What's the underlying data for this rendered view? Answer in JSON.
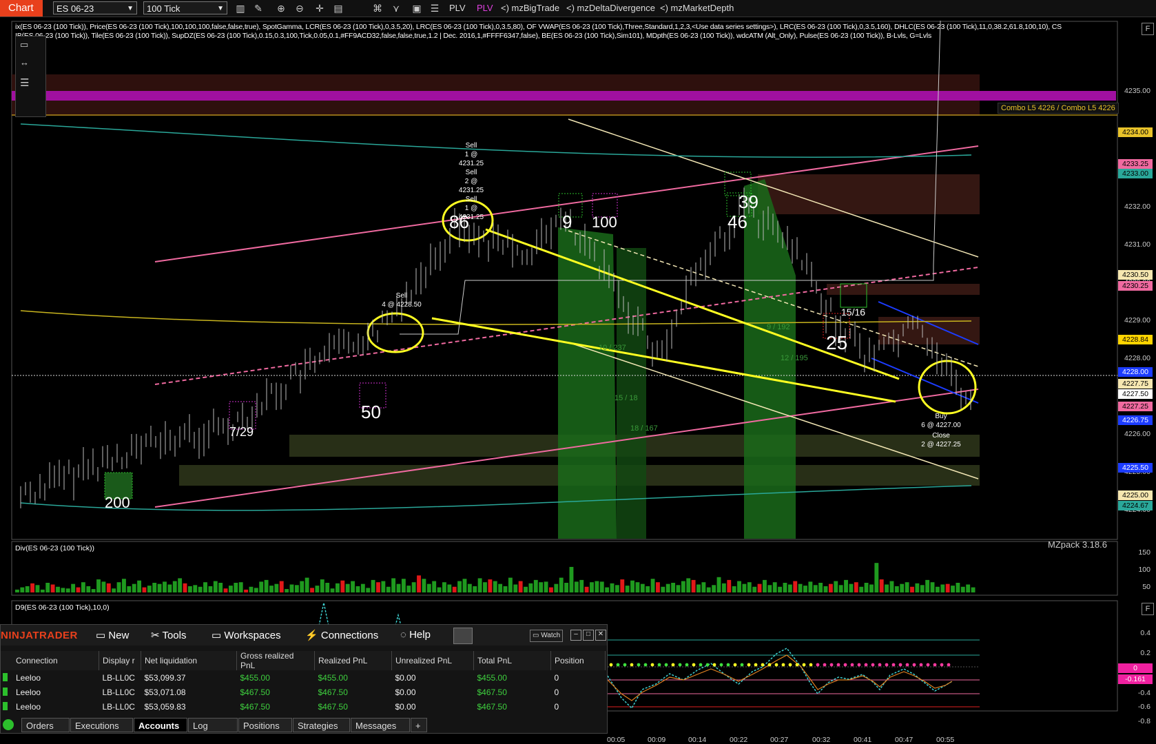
{
  "toolbar": {
    "chart_tab": "Chart",
    "instrument": "ES 06-23",
    "interval": "100 Tick",
    "plv1": "PLV",
    "plv2": "PLV",
    "addons": [
      "mzBigTrade",
      "mzDeltaDivergence",
      "mzMarketDepth"
    ]
  },
  "indicator_line1": "ix(ES 06-23 (100 Tick)), Price(ES 06-23 (100 Tick),100,100,100,false,false,true), SpotGamma, LCR(ES 06-23 (100 Tick),0,3.5,20), LRC(ES 06-23 (100 Tick),0,3.5,80), OF VWAP(ES 06-23 (100 Tick),Three,Standard,1,2,3,<Use data series settings>), LRC(ES 06-23 (100 Tick),0,3.5,160), DHLC(ES 06-23 (100 Tick),11,0,38.2,61.8,100,10), CS",
  "indicator_line2": "IB(ES 06-23 (100 Tick)), Tile(ES 06-23 (100 Tick)), SupDZ(ES 06-23 (100 Tick),0.15,0.3,100,Tick,0.05,0.1,#FF9ACD32,false,false,true,1.2 | Dec. 2016,1,#FFFF6347,false), BE(ES 06-23 (100 Tick),Sim101), MDpth(ES 06-23 (100 Tick)), wdcATM (Alt_Only), Pulse(ES 06-23 (100 Tick)), B-Lvls, G=Lvls",
  "combo_label": "Combo L5 4226 / Combo L5 4226",
  "price_axis": [
    "4235.00",
    "4234.00",
    "4233.00",
    "4232.00",
    "4231.00",
    "4230.00",
    "4229.00",
    "4228.00",
    "4227.00",
    "4226.00",
    "4225.00",
    "4224.00"
  ],
  "price_tags": [
    {
      "text": "4234.00",
      "color": "#e8c22a"
    },
    {
      "text": "4233.25",
      "color": "#f06aa0"
    },
    {
      "text": "4233.00",
      "color": "#2aa89a"
    },
    {
      "text": "4230.50",
      "color": "#f6e7b0"
    },
    {
      "text": "4230.25",
      "color": "#f06aa0"
    },
    {
      "text": "4228.84",
      "color": "#ffd400"
    },
    {
      "text": "4228.00",
      "color": "#1c3cff"
    },
    {
      "text": "4227.75",
      "color": "#f6e7b0"
    },
    {
      "text": "4227.50",
      "color": "#ffffff"
    },
    {
      "text": "4227.25",
      "color": "#f06aa0"
    },
    {
      "text": "4226.75",
      "color": "#1c3cff"
    },
    {
      "text": "4225.50",
      "color": "#1c3cff"
    },
    {
      "text": "4225.00",
      "color": "#f6e7b0"
    },
    {
      "text": "4224.67",
      "color": "#2aa89a"
    }
  ],
  "annotations": {
    "sell_top": [
      "Sell",
      "1 @ 4231.25",
      "Sell",
      "2 @ 4231.25",
      "Sell",
      "1 @ 4231.25"
    ],
    "sell_mid": [
      "Sell",
      "4 @ 4228.50"
    ],
    "buy": [
      "Buy",
      "6 @ 4227.00"
    ],
    "close": [
      "Close",
      "2 @ 4227.25"
    ]
  },
  "big_numbers": [
    "86",
    "9",
    "100",
    "39",
    "46",
    "50",
    "7/29",
    "200",
    "25",
    "15/16"
  ],
  "small_labels": [
    "10 / 237",
    "9 / 192",
    "12 / 195",
    "15 / 18",
    "18 / 167"
  ],
  "watermark": "MZpack 3.18.6",
  "div_panel": {
    "title": "Div(ES 06-23 (100 Tick))",
    "axis": [
      "150",
      "100",
      "50"
    ]
  },
  "d9_panel": {
    "title": "D9(ES 06-23 (100 Tick),10,0)",
    "axis": [
      "0.4",
      "0.2",
      "0",
      "-0.161",
      "-0.4",
      "-0.6",
      "-0.8"
    ]
  },
  "time_axis": [
    "00:05",
    "00:09",
    "00:14",
    "00:22",
    "00:27",
    "00:32",
    "00:41",
    "00:47",
    "00:55"
  ],
  "chart_data": {
    "type": "bar",
    "title": "Div(ES 06-23 (100 Tick))",
    "ylim": [
      0,
      170
    ],
    "values": [
      10,
      18,
      22,
      32,
      26,
      10,
      34,
      28,
      20,
      16,
      14,
      30,
      18,
      36,
      22,
      12,
      46,
      38,
      32,
      14,
      36,
      48,
      22,
      30,
      42,
      18,
      24,
      34,
      30,
      38,
      28,
      40,
      50,
      32,
      22,
      26,
      20,
      36,
      22,
      40,
      34,
      14,
      24,
      34,
      36,
      10,
      20,
      16,
      38,
      44,
      24,
      30,
      40,
      12,
      28,
      26,
      40,
      52,
      16,
      24,
      46,
      34,
      14,
      32,
      42,
      30,
      40,
      22,
      30,
      16,
      44,
      36,
      40,
      20,
      50,
      30,
      48,
      24,
      36,
      60,
      48,
      30,
      40,
      18,
      36,
      28,
      20,
      40,
      48,
      30,
      22,
      50,
      36,
      46,
      40,
      30,
      22,
      52,
      28,
      40,
      20,
      32,
      44,
      36,
      38,
      18,
      30,
      52,
      34,
      90,
      38,
      44,
      20,
      36,
      40,
      38,
      18,
      32,
      26,
      46,
      24,
      42,
      36,
      30,
      22,
      48,
      36,
      20,
      30,
      34,
      26,
      40,
      50,
      44,
      28,
      36,
      18,
      26,
      54,
      32,
      44,
      22,
      40,
      30,
      36,
      20,
      30,
      44,
      26,
      36,
      20,
      34,
      28,
      40,
      30,
      24,
      38,
      26,
      34,
      22,
      30,
      40,
      26,
      44,
      30,
      36,
      20,
      34,
      28,
      104,
      46,
      28,
      40,
      22,
      30,
      36,
      20,
      32,
      26,
      44,
      36,
      20,
      28,
      30,
      24,
      34,
      20,
      28,
      18
    ],
    "colors_red_indices": [
      3,
      7,
      12,
      18,
      25,
      33,
      41,
      45,
      52,
      58,
      64,
      71,
      79,
      86,
      93,
      99,
      105,
      112,
      119,
      126,
      133,
      140,
      146,
      153,
      160,
      165,
      170,
      176,
      183
    ]
  },
  "control_center": {
    "brand": "NINJATRADER",
    "menu": [
      "New",
      "Tools",
      "Workspaces",
      "Connections",
      "Help"
    ],
    "watch": "Watch",
    "columns": [
      "Connection",
      "Display r",
      "Net liquidation",
      "Gross realized PnL",
      "Realized PnL",
      "Unrealized PnL",
      "Total PnL",
      "Position"
    ],
    "rows": [
      [
        "Leeloo",
        "LB-LL0C",
        "$53,099.37",
        "$455.00",
        "$455.00",
        "$0.00",
        "$455.00",
        "0"
      ],
      [
        "Leeloo",
        "LB-LL0C",
        "$53,071.08",
        "$467.50",
        "$467.50",
        "$0.00",
        "$467.50",
        "0"
      ],
      [
        "Leeloo",
        "LB-LL0C",
        "$53,059.83",
        "$467.50",
        "$467.50",
        "$0.00",
        "$467.50",
        "0"
      ]
    ],
    "tabs": [
      "Orders",
      "Executions",
      "Accounts",
      "Log",
      "Positions",
      "Strategies",
      "Messages",
      "+"
    ]
  }
}
